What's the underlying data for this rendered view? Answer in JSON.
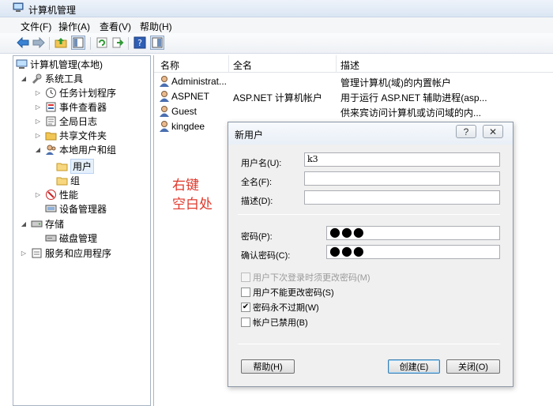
{
  "window": {
    "title": "计算机管理"
  },
  "menu": [
    "文件(F)",
    "操作(A)",
    "查看(V)",
    "帮助(H)"
  ],
  "toolbar": {
    "buttons": [
      "back-icon",
      "forward-icon",
      "up-icon",
      "show-hide-tree-icon",
      "refresh-icon",
      "export-icon",
      "help-icon",
      "properties-icon"
    ]
  },
  "tree": {
    "root": "计算机管理(本地)",
    "system_tools": "系统工具",
    "task_scheduler": "任务计划程序",
    "event_viewer": "事件查看器",
    "shared_folders_log": "全局日志",
    "shared_folders": "共享文件夹",
    "local_users_groups": "本地用户和组",
    "users": "用户",
    "groups": "组",
    "performance": "性能",
    "device_manager": "设备管理器",
    "storage": "存储",
    "disk_management": "磁盘管理",
    "services_apps": "服务和应用程序"
  },
  "list": {
    "columns": [
      "名称",
      "全名",
      "描述"
    ],
    "rows": [
      {
        "name": "Administrat...",
        "fullname": "",
        "description": "管理计算机(域)的内置帐户"
      },
      {
        "name": "ASPNET",
        "fullname": "ASP.NET 计算机帐户",
        "description": "用于运行 ASP.NET 辅助进程(asp..."
      },
      {
        "name": "Guest",
        "fullname": "",
        "description": "供来宾访问计算机或访问域的内..."
      },
      {
        "name": "kingdee",
        "fullname": "",
        "description": ""
      }
    ]
  },
  "annotation": {
    "line1": "右键",
    "line2": "空白处",
    "color": "#e0382b"
  },
  "dialog": {
    "title": "新用户",
    "help_btn": "?",
    "close_btn": "✕",
    "username_label": "用户名(U):",
    "username_value": "k3",
    "fullname_label": "全名(F):",
    "fullname_value": "",
    "description_label": "描述(D):",
    "description_value": "",
    "password_label": "密码(P):",
    "password_value": "●●●",
    "confirm_label": "确认密码(C):",
    "confirm_value": "●●●",
    "chk_must_change": "用户下次登录时须更改密码(M)",
    "chk_cannot_change": "用户不能更改密码(S)",
    "chk_never_expires": "密码永不过期(W)",
    "chk_disabled": "帐户已禁用(B)",
    "chk_must_change_checked": false,
    "chk_cannot_change_checked": false,
    "chk_never_expires_checked": true,
    "chk_disabled_checked": false,
    "help_button": "帮助(H)",
    "create_button": "创建(E)",
    "close_button": "关闭(O)"
  }
}
